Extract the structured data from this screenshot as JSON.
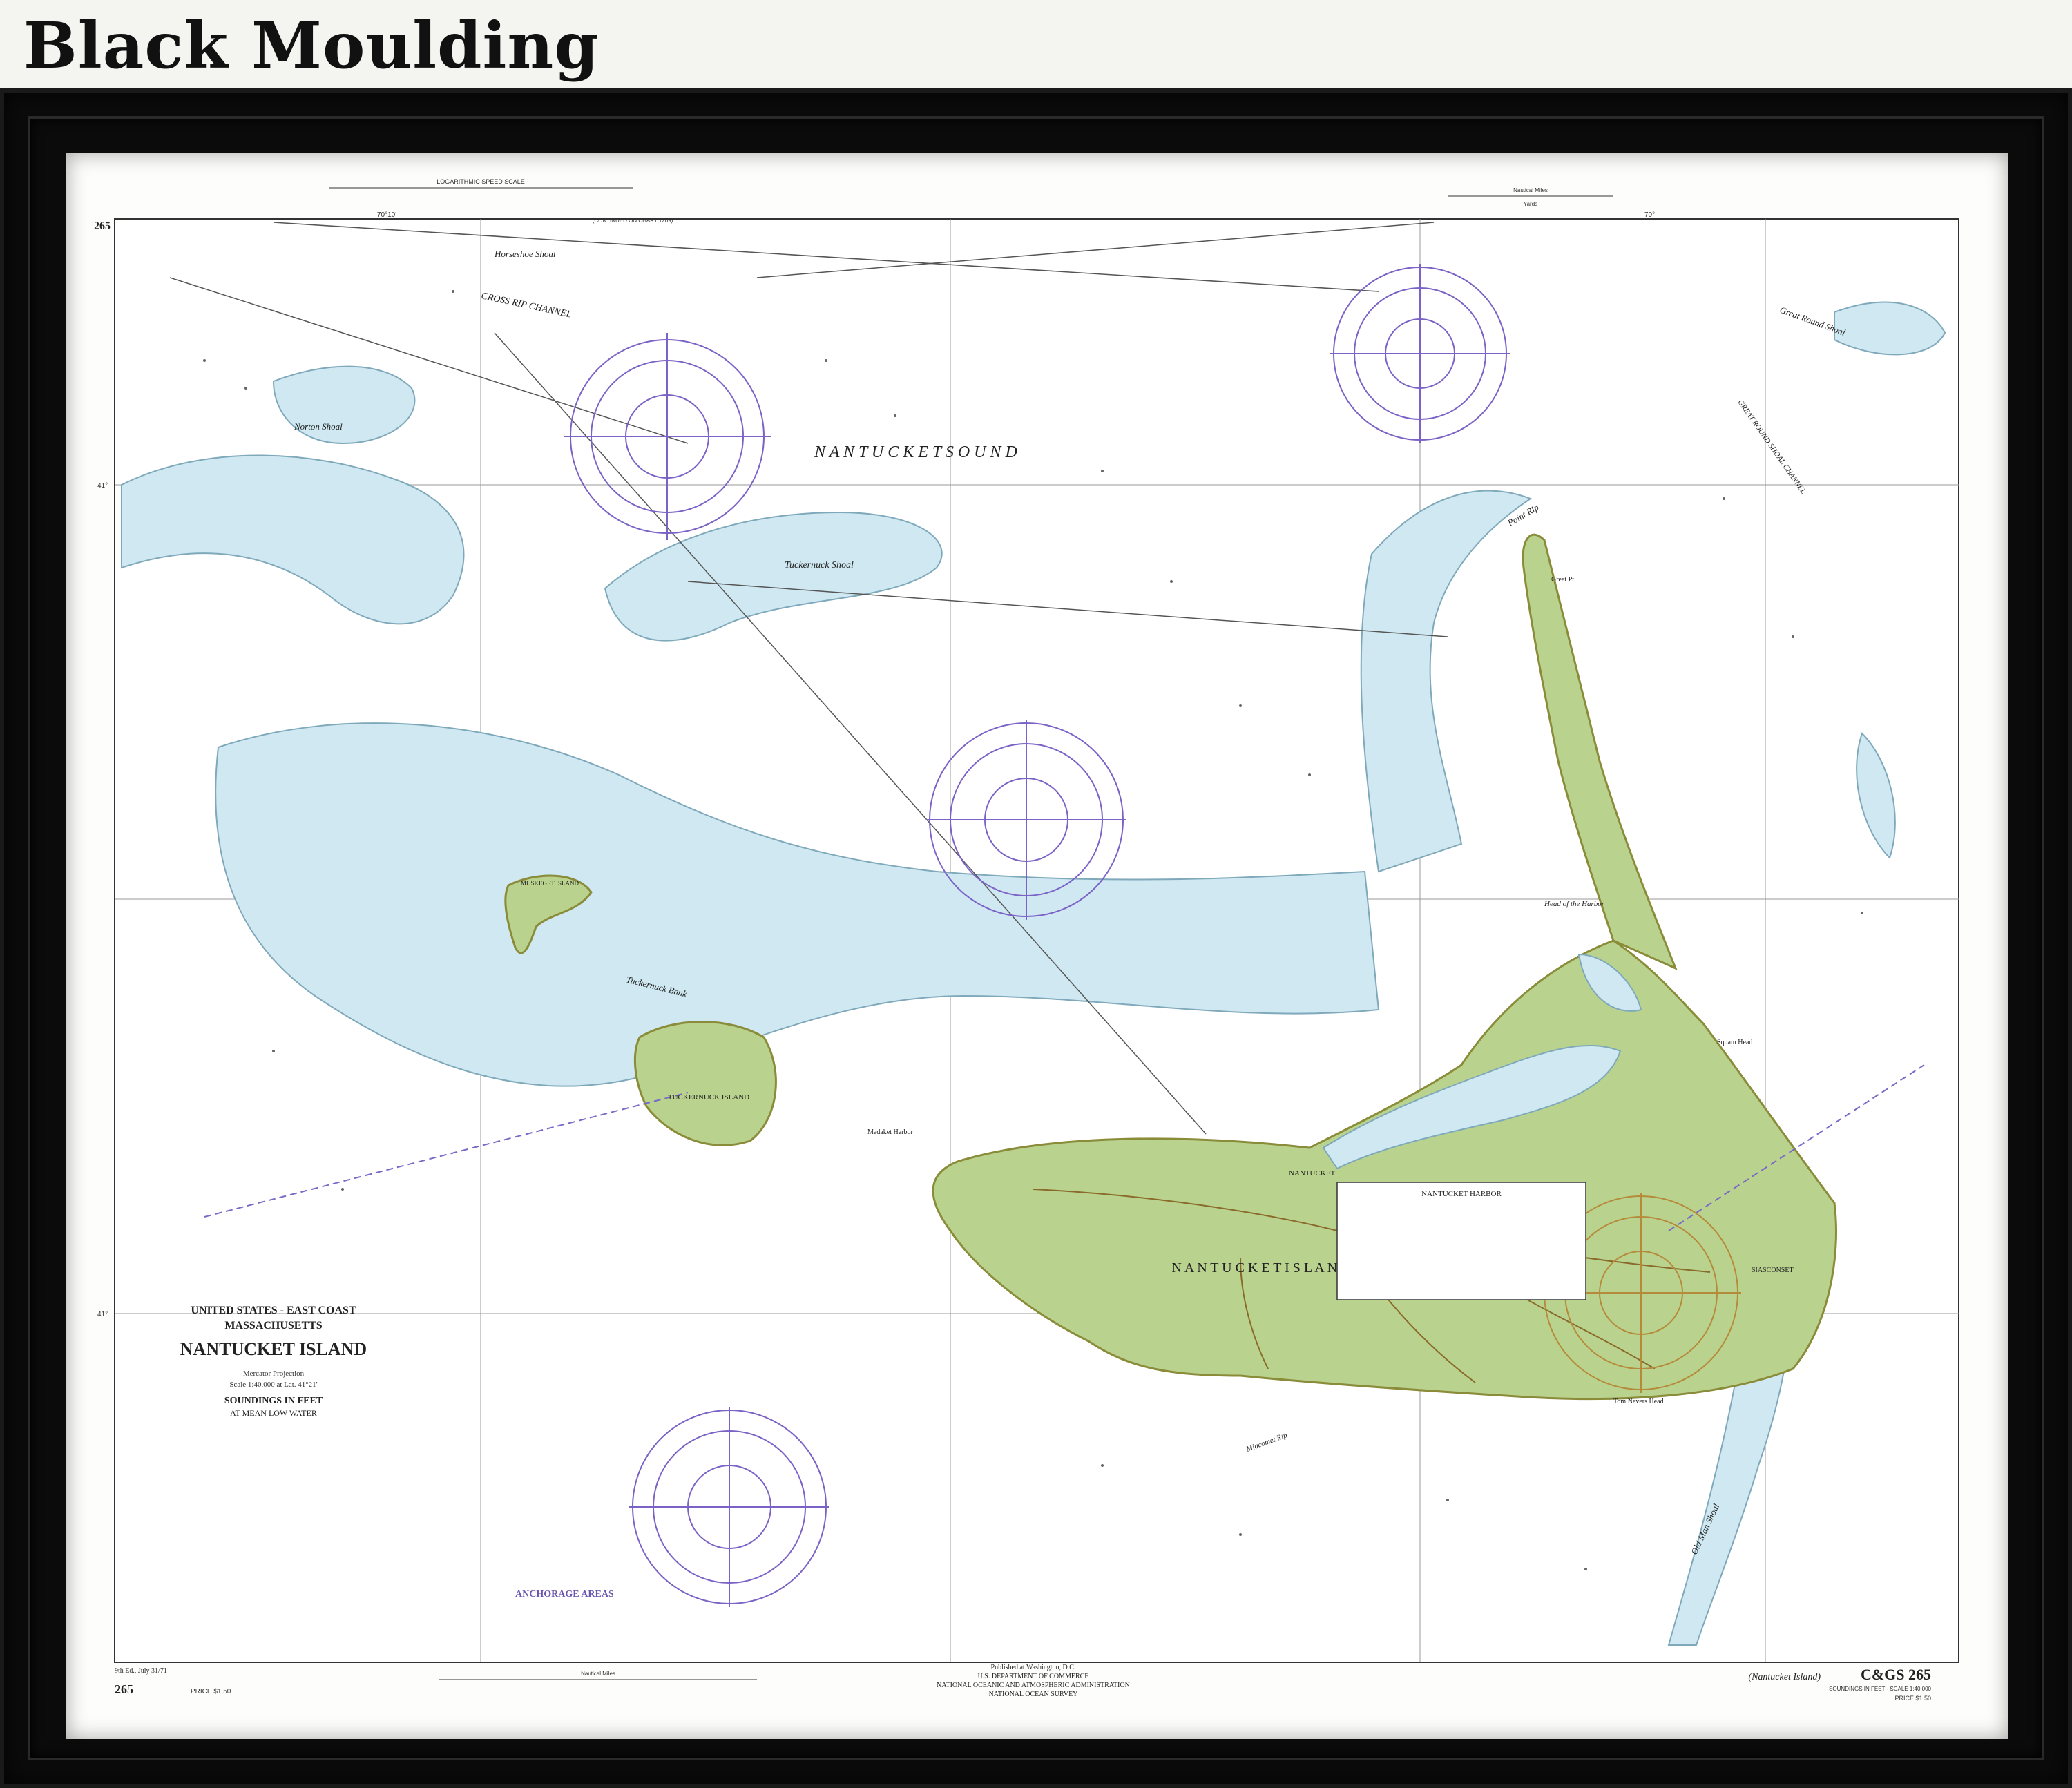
{
  "heading": "Black Moulding",
  "chart": {
    "number_top": "265",
    "number_bottom": "265",
    "edition": "9th Ed., July 31/71",
    "price": "PRICE $1.50",
    "price_right": "PRICE $1.50",
    "title_block": {
      "region": "UNITED STATES - EAST COAST",
      "state": "MASSACHUSETTS",
      "name": "NANTUCKET ISLAND",
      "projection": "Mercator Projection",
      "scale": "Scale 1:40,000 at Lat. 41°21'",
      "soundings": "SOUNDINGS IN FEET",
      "datum": "AT MEAN LOW WATER"
    },
    "water_labels": {
      "sound": "N A N T U C K E T   S O U N D",
      "cross_rip": "CROSS RIP CHANNEL",
      "tuckernuck_shoal": "Tuckernuck Shoal",
      "norton_shoal": "Norton Shoal",
      "horseshoe_shoal": "Horseshoe Shoal",
      "great_round_shoal": "Great Round Shoal",
      "great_round_channel": "GREAT ROUND SHOAL CHANNEL",
      "tuckernuck_bank": "Tuckernuck Bank",
      "point_rip": "Point Rip",
      "old_man_shoal": "Old Man Shoal",
      "miacomet_rip": "Miacomet Rip",
      "head_harbor": "Head of the Harbor"
    },
    "land_labels": {
      "nantucket_island": "N A N T U C K E T   I S L A N D",
      "tuckernuck_island": "TUCKERNUCK ISLAND",
      "muskeget_island": "MUSKEGET ISLAND",
      "nantucket_town": "NANTUCKET",
      "siasconset": "SIASCONSET",
      "madaket": "Madaket Harbor",
      "squam_head": "Squam Head",
      "tom_nevers": "Tom Nevers Head",
      "great_pt": "Great Pt"
    },
    "harbor_box_title": "NANTUCKET HARBOR",
    "anchorage_title": "ANCHORAGE AREAS",
    "publisher": {
      "line1": "Published at Washington, D.C.",
      "line2": "U.S. DEPARTMENT OF COMMERCE",
      "line3": "NATIONAL OCEANIC AND ATMOSPHERIC ADMINISTRATION",
      "line4": "NATIONAL OCEAN SURVEY"
    },
    "cgs": "C&GS 265",
    "cgs_sub": "(Nantucket Island)",
    "cgs_scale": "SOUNDINGS IN FEET - SCALE 1:40,000",
    "speed_scale_title": "LOGARITHMIC SPEED SCALE",
    "nautical_miles": "Nautical Miles",
    "yards": "Yards",
    "continued": "(CONTINUED ON CHART 1209)",
    "lon_70_10": "70°10'",
    "lon_70": "70°",
    "lat_41_20": "41°",
    "lat_41_15": "41°"
  },
  "colors": {
    "land": "#b9d38f",
    "shoal": "#cde9f3",
    "water": "#ffffff",
    "compass": "#7b62c6",
    "frame": "#0b0b0b"
  }
}
